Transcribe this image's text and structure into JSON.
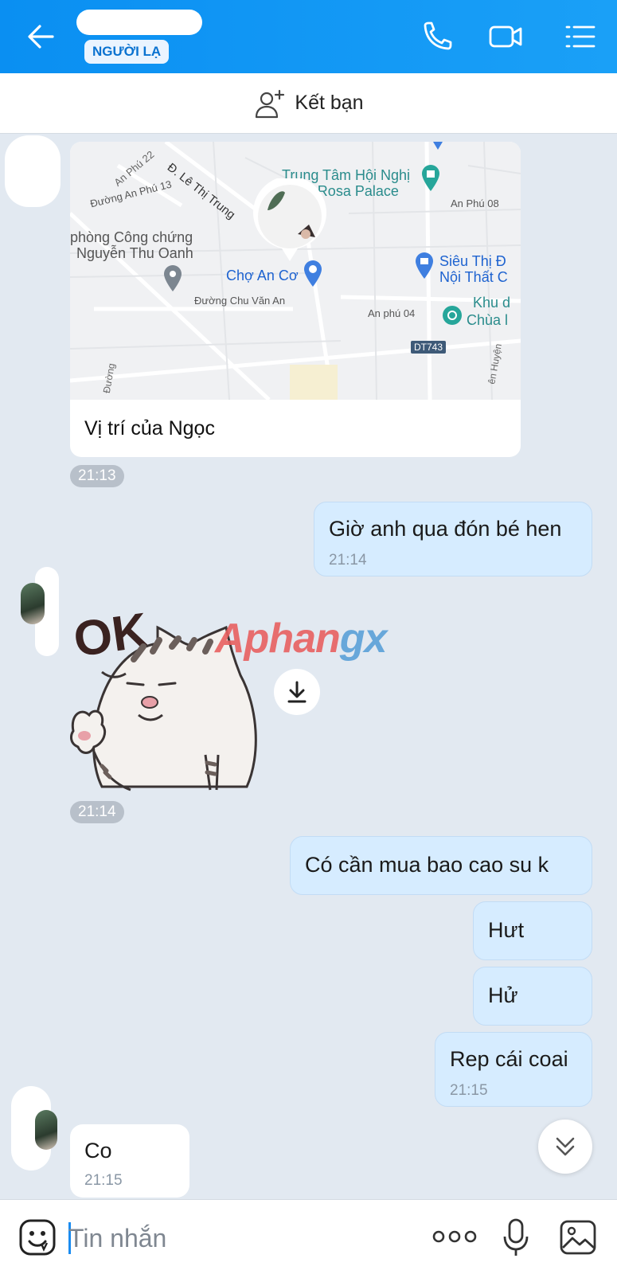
{
  "header": {
    "status_badge": "NGƯỜI LẠ",
    "back_icon": "arrow-left-icon",
    "call_icon": "phone-icon",
    "video_icon": "video-camera-icon",
    "menu_icon": "list-menu-icon",
    "bg_color": "#0a8ff2"
  },
  "friend_bar": {
    "label": "Kết bạn",
    "icon": "add-user-icon"
  },
  "map_message": {
    "caption": "Vị trí của Ngọc",
    "time": "21:13",
    "labels": {
      "an_phu_22": "An Phú 22",
      "le_thi_trung": "Đ. Lê Thị Trung",
      "duong_an_phu_13": "Đường An Phú 13",
      "trung_tam": "Trung Tâm Hội Nghị",
      "rosa_palace": "ới Rosa Palace",
      "an_phu_08": "An Phú 08",
      "cong_chung": "phòng Công chứng",
      "nguyen_thu_oanh": "Nguyễn Thu Oanh",
      "cho_an_co": "Chợ An Cơ",
      "sieu_thi": "Siêu Thị Đ",
      "noi_that": "Nội Thất C",
      "chu_van_an": "Đường Chu Văn An",
      "an_phu_04": "An phú 04",
      "khu_d": "Khu d",
      "chua": "Chùa l",
      "dt743": "DT743",
      "duong": "Đường",
      "en_huyen": "ên Huyện"
    }
  },
  "messages": [
    {
      "id": "m1",
      "dir": "out",
      "text": "Giờ anh qua đón bé hen",
      "time": "21:14"
    },
    {
      "id": "m2",
      "dir": "out",
      "text": "Có cần mua bao cao su k",
      "time": ""
    },
    {
      "id": "m3",
      "dir": "out",
      "text": "Hưt",
      "time": ""
    },
    {
      "id": "m4",
      "dir": "out",
      "text": "Hử",
      "time": ""
    },
    {
      "id": "m5",
      "dir": "out",
      "text": "Rep cái coai",
      "time": "21:15"
    },
    {
      "id": "m6",
      "dir": "in",
      "text": "Co",
      "time": "21:15"
    }
  ],
  "sticker": {
    "text": "OK",
    "time": "21:14",
    "download_icon": "download-icon"
  },
  "watermark": {
    "part1": "Aphan",
    "part2": "gx"
  },
  "input": {
    "placeholder": "Tin nhắn",
    "emoji_icon": "emoji-icon",
    "more_icon": "more-dots-icon",
    "mic_icon": "microphone-icon",
    "image_icon": "image-icon"
  },
  "scroll_icon": "chevron-double-down-icon"
}
